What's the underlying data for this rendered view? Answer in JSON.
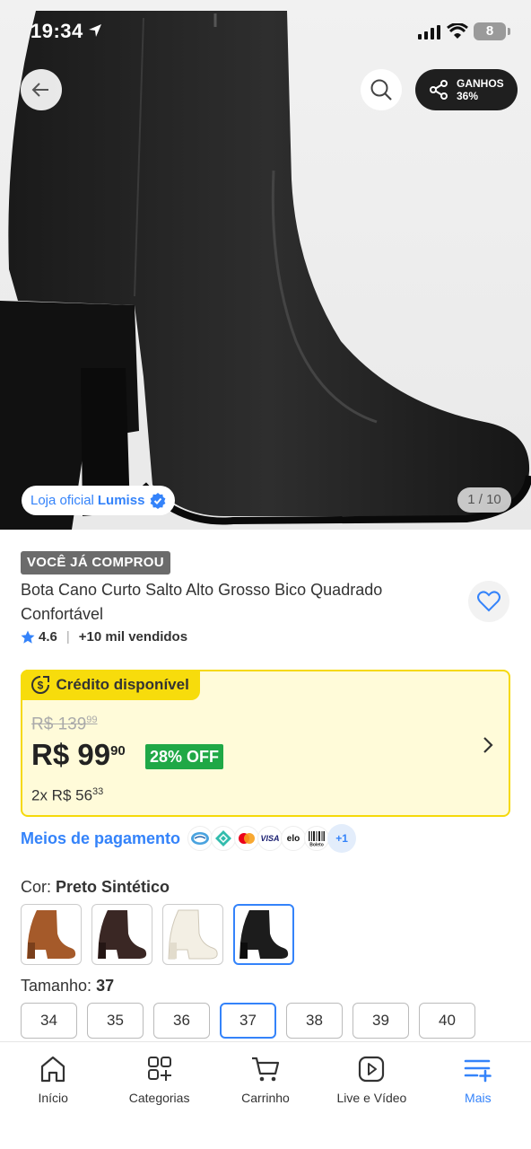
{
  "status_bar": {
    "time": "19:34",
    "battery": "8"
  },
  "header": {
    "share_label": "GANHOS",
    "share_value": "36%"
  },
  "gallery": {
    "store_prefix": "Loja oficial",
    "store_name": "Lumiss",
    "counter": "1 / 10"
  },
  "product": {
    "bought_badge": "VOCÊ JÁ COMPROU",
    "title": "Bota Cano Curto Salto Alto Grosso Bico Quadrado Confortável",
    "rating": "4.6",
    "sold": "+10 mil vendidos"
  },
  "price": {
    "credit_label": "Crédito disponível",
    "old_main": "R$ 139",
    "old_cents": "99",
    "new_main": "R$ 99",
    "new_cents": "90",
    "discount": "28% OFF",
    "installments_main": "2x R$ 56",
    "installments_cents": "33"
  },
  "payment": {
    "label": "Meios de pagamento",
    "methods": [
      "mercado-pago",
      "pix",
      "mastercard",
      "VISA",
      "elo",
      "Boleto"
    ],
    "more": "+1"
  },
  "color": {
    "label": "Cor:",
    "selected": "Preto Sintético",
    "options": [
      "caramelo",
      "marrom",
      "branco",
      "preto"
    ]
  },
  "size": {
    "label": "Tamanho:",
    "selected": "37",
    "options": [
      "34",
      "35",
      "36",
      "37",
      "38",
      "39",
      "40"
    ]
  },
  "nav": {
    "items": [
      "Início",
      "Categorias",
      "Carrinho",
      "Live e Vídeo",
      "Mais"
    ]
  },
  "colors": {
    "accent": "#3483fa",
    "credit_yellow": "#f7dc0c",
    "discount_green": "#1fa846"
  }
}
